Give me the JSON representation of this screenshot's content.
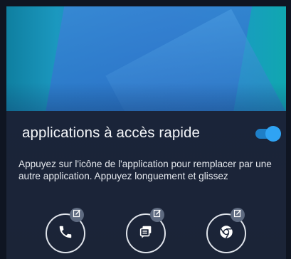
{
  "panel": {
    "title": "applications à accès rapide",
    "toggle_on": true,
    "description": "Appuyez sur l'icône de l'application pour remplacer par une autre application. Appuyez longuement et glissez"
  },
  "apps": [
    {
      "icon": "phone-icon"
    },
    {
      "icon": "messages-icon"
    },
    {
      "icon": "chrome-icon"
    }
  ],
  "colors": {
    "panel_bg": "#1b2438",
    "toggle_accent": "#2fa3f3",
    "text": "#f3f5f8"
  }
}
